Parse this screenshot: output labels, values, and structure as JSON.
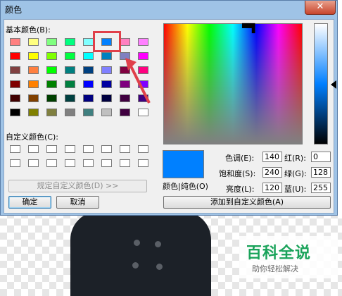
{
  "dialog": {
    "title": "颜色",
    "close_label": "✕"
  },
  "basic_colors_label": "基本颜色(B):",
  "custom_colors_label": "自定义颜色(C):",
  "basic_colors": [
    [
      "#ff8080",
      "#ffff80",
      "#80ff80",
      "#00ff80",
      "#80ffff",
      "#0080ff",
      "#ff80c0",
      "#ff80ff"
    ],
    [
      "#ff0000",
      "#ffff00",
      "#80ff00",
      "#00ff40",
      "#00ffff",
      "#0080c0",
      "#8080c0",
      "#ff00ff"
    ],
    [
      "#804040",
      "#ff8040",
      "#00ff00",
      "#008080",
      "#004080",
      "#8080ff",
      "#800040",
      "#ff0080"
    ],
    [
      "#800000",
      "#ff8000",
      "#008000",
      "#008040",
      "#0000ff",
      "#0000a0",
      "#800080",
      "#8000ff"
    ],
    [
      "#400000",
      "#804000",
      "#004000",
      "#004040",
      "#000080",
      "#000040",
      "#400040",
      "#400080"
    ],
    [
      "#000000",
      "#808000",
      "#808040",
      "#808080",
      "#408080",
      "#c0c0c0",
      "#400040",
      "#ffffff"
    ]
  ],
  "selected_swatch": "#0080ff",
  "define_custom_button": "规定自定义颜色(D) >>",
  "ok_button": "确定",
  "cancel_button": "取消",
  "preview_label": "颜色|纯色(O)",
  "hue": {
    "label": "色调(E):",
    "value": "140"
  },
  "sat": {
    "label": "饱和度(S):",
    "value": "240"
  },
  "lum": {
    "label": "亮度(L):",
    "value": "120"
  },
  "red": {
    "label": "红(R):",
    "value": "0"
  },
  "green": {
    "label": "绿(G):",
    "value": "128"
  },
  "blue": {
    "label": "蓝(U):",
    "value": "255"
  },
  "add_custom_button": "添加到自定义颜色(A)",
  "watermark": {
    "title": "百科全说",
    "subtitle": "助你轻松解决"
  },
  "colors": {
    "accent_frame": "#e0404a",
    "preview": "#0080ff",
    "titlebar": "#9fc3e6"
  }
}
